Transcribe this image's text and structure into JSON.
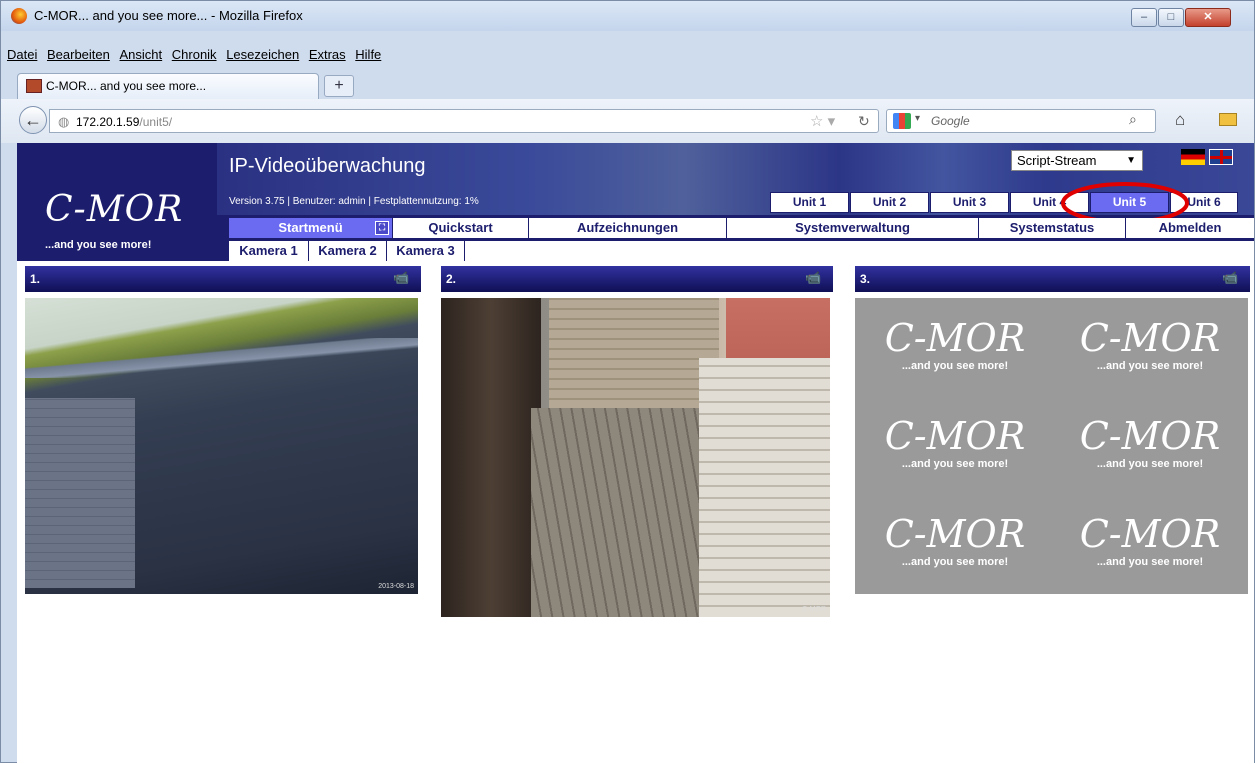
{
  "browser": {
    "title": "C-MOR... and you see more... - Mozilla Firefox",
    "menu": [
      "Datei",
      "Bearbeiten",
      "Ansicht",
      "Chronik",
      "Lesezeichen",
      "Extras",
      "Hilfe"
    ],
    "tab_label": "C-MOR... and you see more...",
    "new_tab": "+",
    "url_host": "172.20.1.59",
    "url_path": "/unit5/",
    "search_placeholder": "Google",
    "window_buttons": {
      "min": "–",
      "max": "□",
      "close": "✕"
    }
  },
  "app": {
    "logo": "C-MOR",
    "slogan": "...and you see more!",
    "title": "IP-Videoüberwachung",
    "version_info": "Version 3.75 | Benutzer: admin | Festplattennutzung: 1%",
    "stream_select": "Script-Stream",
    "units": [
      "Unit 1",
      "Unit 2",
      "Unit 3",
      "Unit 4",
      "Unit 5",
      "Unit 6"
    ],
    "active_unit": "Unit 5",
    "nav": [
      "Startmenü",
      "Quickstart",
      "Aufzeichnungen",
      "Systemverwaltung",
      "Systemstatus",
      "Abmelden"
    ],
    "subnav": [
      "Kamera 1",
      "Kamera 2",
      "Kamera 3"
    ],
    "panels": [
      {
        "label": "1.",
        "camera_icon": "security-camera-icon"
      },
      {
        "label": "2.",
        "camera_icon": "security-camera-icon"
      },
      {
        "label": "3.",
        "camera_icon": "security-camera-icon"
      }
    ]
  },
  "colors": {
    "header": "#1d1d6e",
    "active": "#6b6bf2",
    "highlight_circle": "#e00000"
  }
}
